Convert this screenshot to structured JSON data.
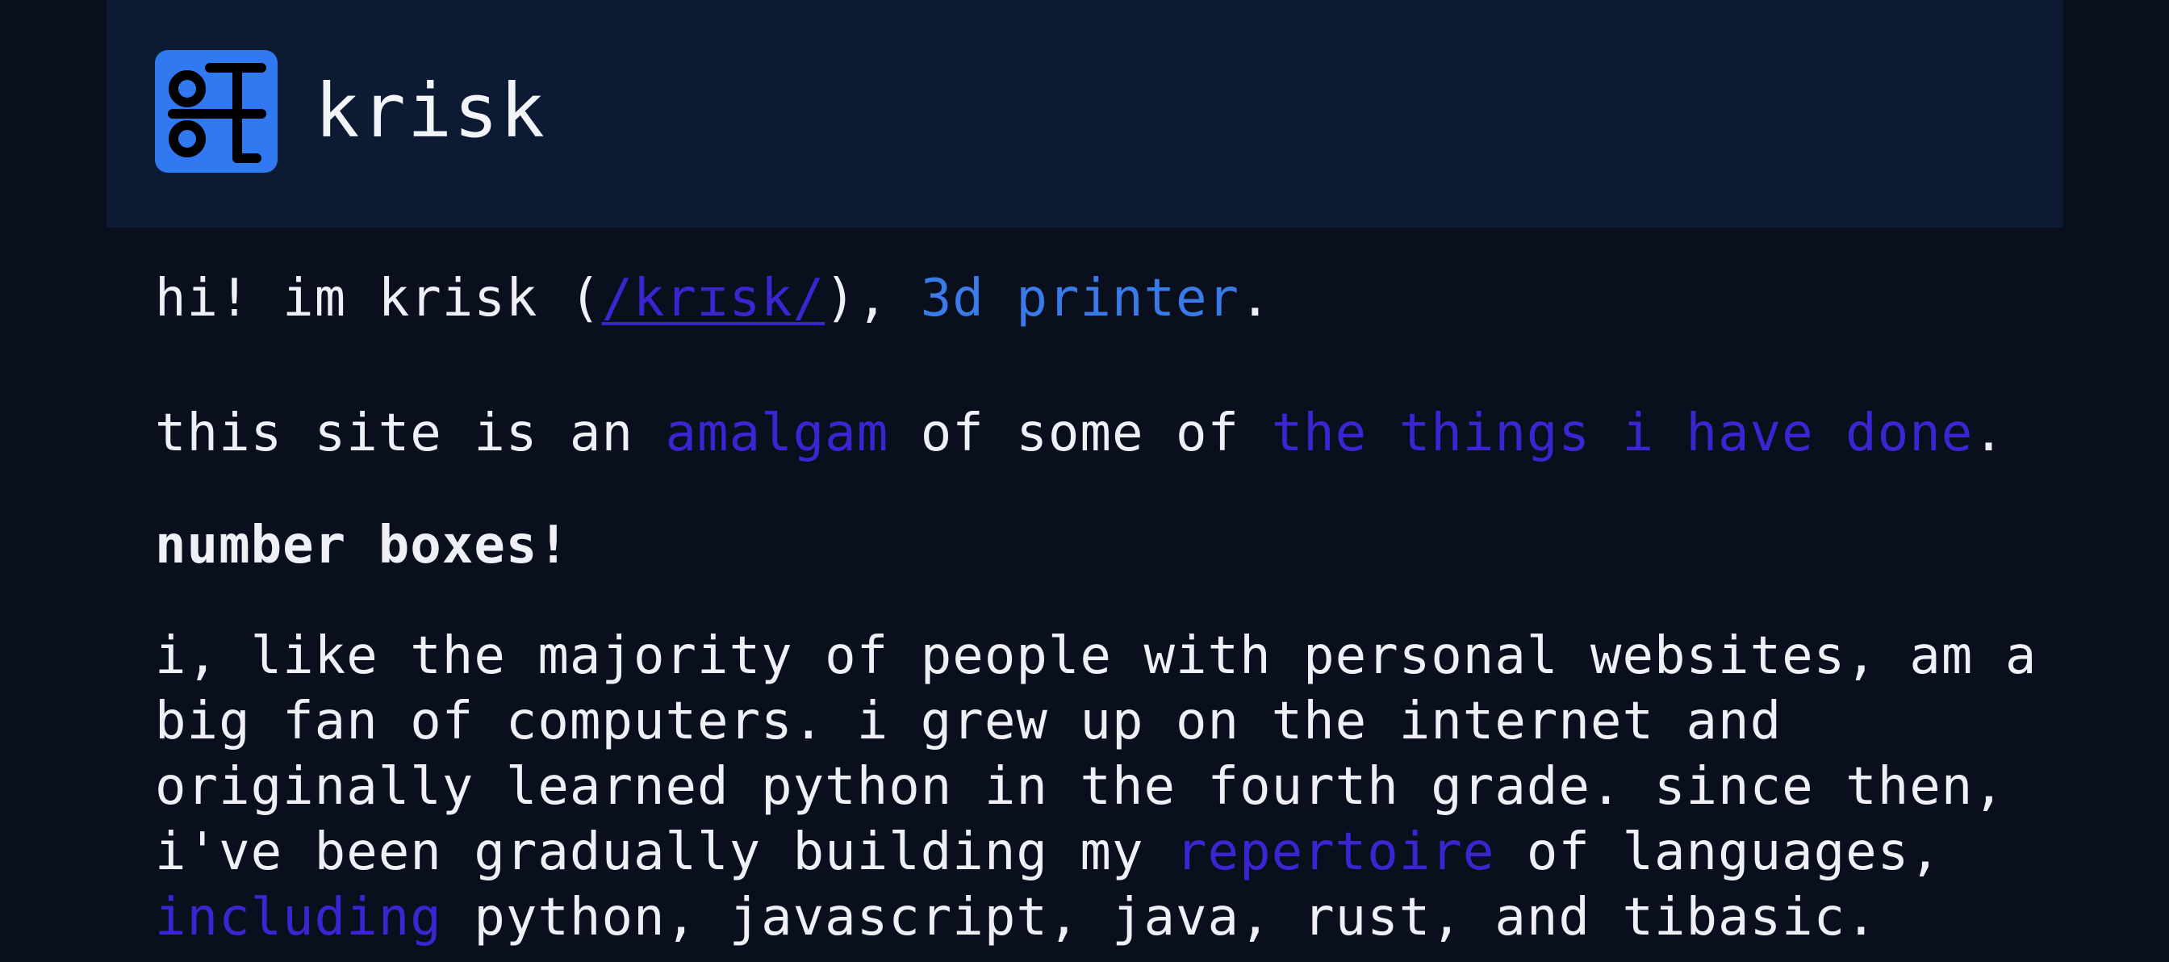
{
  "header": {
    "logo_icon": "krisk-logo-icon",
    "title": "krisk"
  },
  "intro": {
    "prefix": "hi! im krisk (",
    "pronunciation": "/krɪsk/",
    "middle": "), ",
    "role_link": "3d printer",
    "suffix": "."
  },
  "site_desc": {
    "prefix": "this site is an ",
    "amalgam_link": "amalgam",
    "middle": " of some of ",
    "things_link": "the things i have done",
    "suffix": "."
  },
  "section_title": "number boxes!",
  "paragraph": {
    "line1": "i, like the majority of people with personal websites, am a",
    "line2": "big fan of computers. i grew up on the internet and",
    "line3": "originally learned python in the fourth grade. since then,",
    "line4_prefix": "i've been gradually building my ",
    "repertoire_link": "repertoire",
    "line4_suffix": " of languages,",
    "including_link": "including",
    "line5_suffix": " python, javascript, java, rust, and tibasic."
  },
  "colors": {
    "background": "#0a0f1e",
    "header_bg": "#0c1a34",
    "accent_blue": "#3a7bea",
    "accent_purple": "#3a25d0",
    "logo_bg": "#3079f0"
  }
}
